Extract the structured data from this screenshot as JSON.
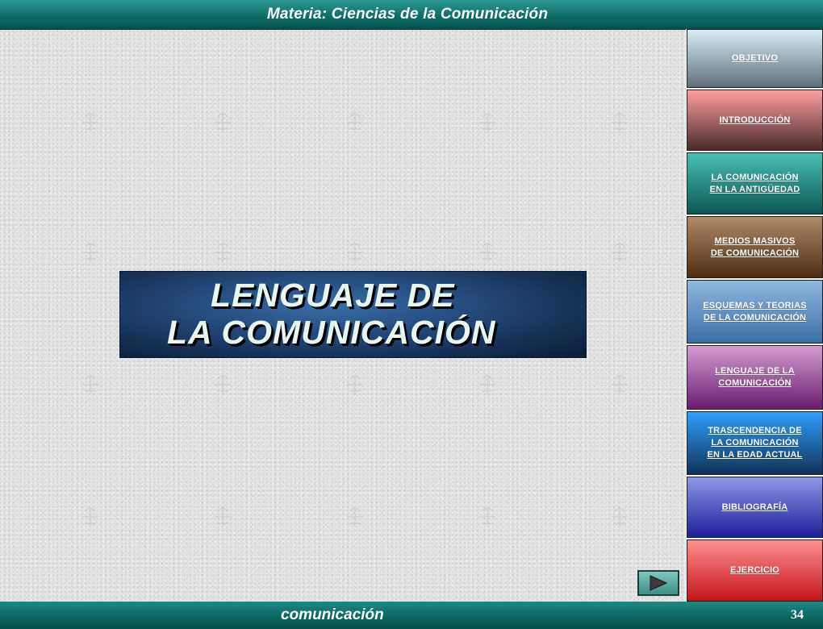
{
  "header": {
    "title": "Materia: Ciencias de la Comunicación"
  },
  "banner": {
    "line1": "LENGUAJE DE",
    "line2": "LA COMUNICACIÓN"
  },
  "sidebar": {
    "items": [
      {
        "label": "OBJETIVO",
        "color_top": "#d8eef6",
        "color_bottom": "#5f6f7a"
      },
      {
        "label": "INTRODUCCIÓN",
        "color_top": "#ff9ea0",
        "color_bottom": "#4a2a2c"
      },
      {
        "label": "LA COMUNICACIÓN \nEN LA ANTIGÜEDAD",
        "color_top": "#49bfb3",
        "color_bottom": "#0b5852"
      },
      {
        "label": "MEDIOS MASIVOS \nDE COMUNICACIÓN",
        "color_top": "#b08a68",
        "color_bottom": "#4f2d12"
      },
      {
        "label": "ESQUEMAS Y TEORIAS \nDE LA COMUNICACIÓN",
        "color_top": "#8fb8de",
        "color_bottom": "#3a6ea8"
      },
      {
        "label": "LENGUAJE DE LA \nCOMUNICACIÓN",
        "color_top": "#d49cd0",
        "color_bottom": "#6a1b72"
      },
      {
        "label": "TRASCENDENCIA DE \nLA COMUNICACIÓN \nEN LA EDAD ACTUAL",
        "color_top": "#2f9fff",
        "color_bottom": "#103258"
      },
      {
        "label": "BIBLIOGRAFÍA",
        "color_top": "#8e97e6",
        "color_bottom": "#1f1f9a"
      },
      {
        "label": "EJERCICIO",
        "color_top": "#ff8f8f",
        "color_bottom": "#c4141a"
      }
    ]
  },
  "footer": {
    "word": "comunicación",
    "page_number": "34"
  },
  "next_button": {
    "icon": "play-triangle-icon",
    "color": "#3d8f87"
  }
}
